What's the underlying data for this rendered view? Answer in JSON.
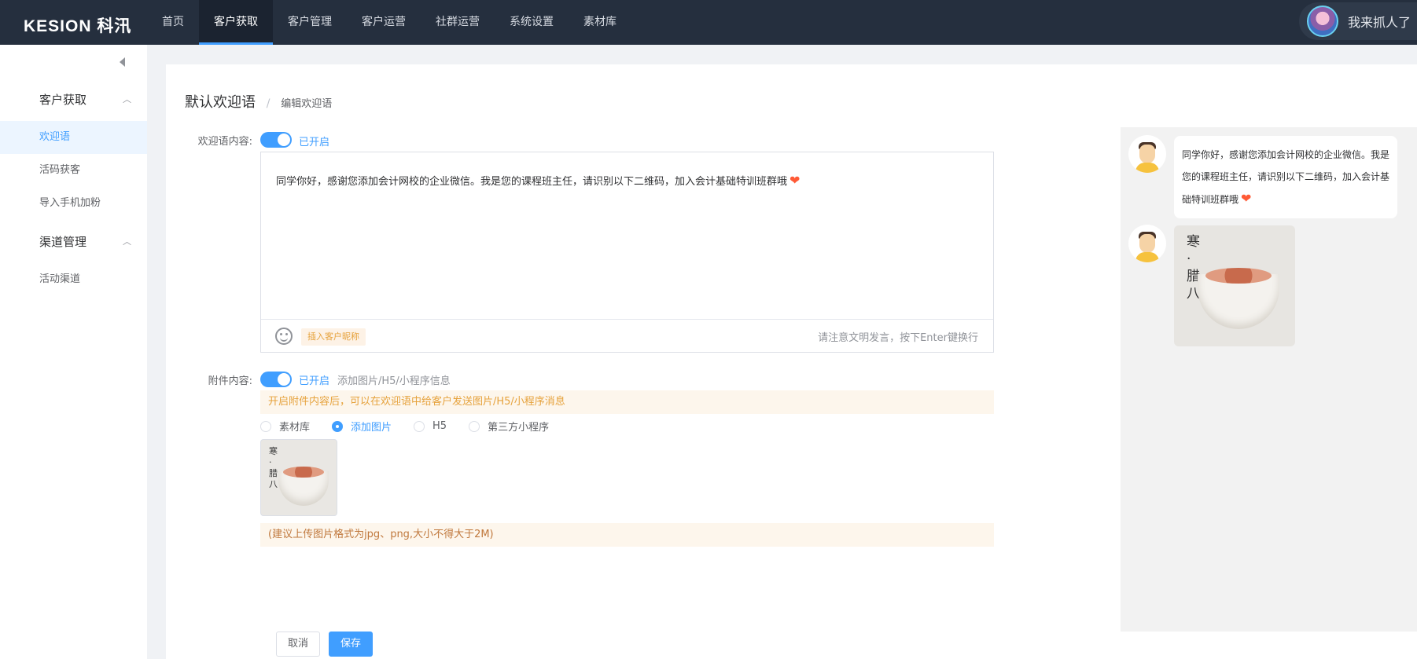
{
  "brand": {
    "logo": "KESION 科汛"
  },
  "nav": [
    {
      "label": "首页"
    },
    {
      "label": "客户获取",
      "active": true
    },
    {
      "label": "客户管理"
    },
    {
      "label": "客户运营"
    },
    {
      "label": "社群运营"
    },
    {
      "label": "系统设置"
    },
    {
      "label": "素材库"
    }
  ],
  "user": {
    "name": "我来抓人了"
  },
  "sidebar": {
    "groups": [
      {
        "title": "客户获取",
        "items": [
          "欢迎语",
          "活码获客",
          "导入手机加粉"
        ]
      },
      {
        "title": "渠道管理",
        "items": [
          "活动渠道"
        ]
      }
    ],
    "active_item": "欢迎语"
  },
  "breadcrumb": {
    "parent": "默认欢迎语",
    "separator": "/",
    "current": "编辑欢迎语"
  },
  "form": {
    "welcome_label": "欢迎语内容:",
    "welcome_switch_text": "已开启",
    "welcome_text": "同学你好，感谢您添加会计网校的企业微信。我是您的课程班主任，请识别以下二维码，加入会计基础特训班群哦",
    "heart_emoji": "❤",
    "insert_nickname": "插入客户昵称",
    "editor_hint": "请注意文明发言，按下Enter键换行",
    "attach_label": "附件内容:",
    "attach_switch_text": "已开启",
    "attach_add": "添加图片/H5/小程序信息",
    "attach_notice": "开启附件内容后，可以在欢迎语中给客户发送图片/H5/小程序消息",
    "radio_options": [
      "素材库",
      "添加图片",
      "H5",
      "第三方小程序"
    ],
    "radio_selected": "添加图片",
    "image_text": "寒·腊八",
    "upload_hint": "(建议上传图片格式为jpg、png,大小不得大于2M)",
    "cancel": "取消",
    "save": "保存"
  },
  "preview": {
    "message": "同学你好，感谢您添加会计网校的企业微信。我是您的课程班主任，请识别以下二维码，加入会计基础特训班群哦",
    "image_text": "寒·腊八"
  },
  "colors": {
    "primary": "#409eff",
    "topbar": "#252f3e",
    "warning": "#e6a23c"
  }
}
